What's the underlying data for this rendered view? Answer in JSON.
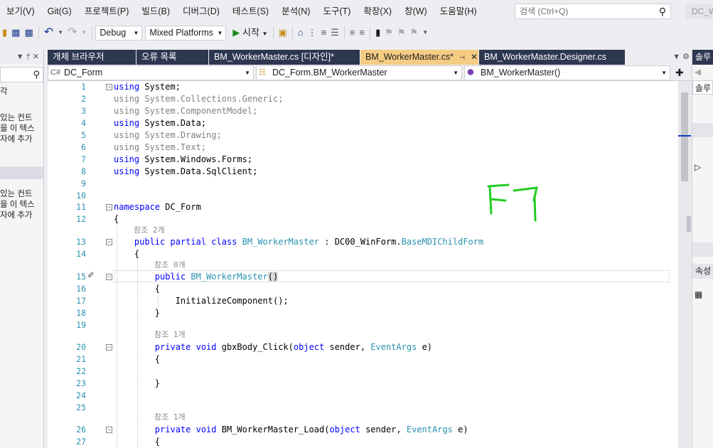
{
  "menu": [
    "보기(V)",
    "Git(G)",
    "프로젝트(P)",
    "빌드(B)",
    "디버그(D)",
    "테스트(S)",
    "분석(N)",
    "도구(T)",
    "확장(X)",
    "창(W)",
    "도움말(H)"
  ],
  "search": {
    "placeholder": "검색 (Ctrl+Q)",
    "icon": "search-icon"
  },
  "solution_name": "DC_W",
  "toolbar": {
    "config": "Debug",
    "platform": "Mixed Platforms",
    "start_label": "시작"
  },
  "left_panel": {
    "texts": [
      "각",
      "있는 컨트",
      "을 이 텍스",
      "자에 추가",
      "있는 컨트",
      "을 이 텍스",
      "자에 추가"
    ]
  },
  "tabs": [
    {
      "label": "개체 브라우저",
      "active": false
    },
    {
      "label": "오류 목록",
      "active": false
    },
    {
      "label": "BM_WorkerMaster.cs [디자인]*",
      "active": false
    },
    {
      "label": "BM_WorkerMaster.cs*",
      "active": true
    },
    {
      "label": "BM_WorkerMaster.Designer.cs",
      "active": false
    }
  ],
  "nav": {
    "project": "DC_Form",
    "class": "DC_Form.BM_WorkerMaster",
    "member": "BM_WorkerMaster()"
  },
  "code": {
    "line_numbers": [
      "1",
      "2",
      "3",
      "4",
      "5",
      "6",
      "7",
      "8",
      "9",
      "10",
      "11",
      "12",
      "13",
      "14",
      "15",
      "16",
      "17",
      "18",
      "19",
      "20",
      "21",
      "22",
      "23",
      "24",
      "25",
      "26",
      "27"
    ],
    "refs": [
      "참조 2개",
      "참조 0개",
      "참조 1개",
      "참조 1개"
    ],
    "using_system": "System;",
    "using_collections": "System.Collections.Generic;",
    "using_component": "System.ComponentModel;",
    "using_data": "System.Data;",
    "using_drawing": "System.Drawing;",
    "using_text": "System.Text;",
    "using_forms": "System.Windows.Forms;",
    "using_sql": "System.Data.SqlClient;",
    "namespace_name": "DC_Form",
    "class_name": "BM_WorkerMaster",
    "base_ns": "DC00_WinForm.",
    "base_class": "BaseMDIChildForm",
    "ctor_name": "BM_WorkerMaster",
    "init_call": "InitializeComponent();",
    "method1": "gbxBody_Click",
    "method2": "BM_WorkerMaster_Load",
    "param_type1": "object",
    "param_name1": "sender",
    "param_type2": "EventArgs",
    "param_name2": "e"
  },
  "annotation_text": "F7",
  "right_panel": {
    "solution_label": "솔루",
    "solution_search": "솔루",
    "props_label": "속성"
  },
  "colors": {
    "accent_tab": "#f5cc84",
    "tab_bg": "#2d3750",
    "keyword": "#0000ff",
    "type": "#2b91af",
    "annotation": "#22cc22"
  }
}
